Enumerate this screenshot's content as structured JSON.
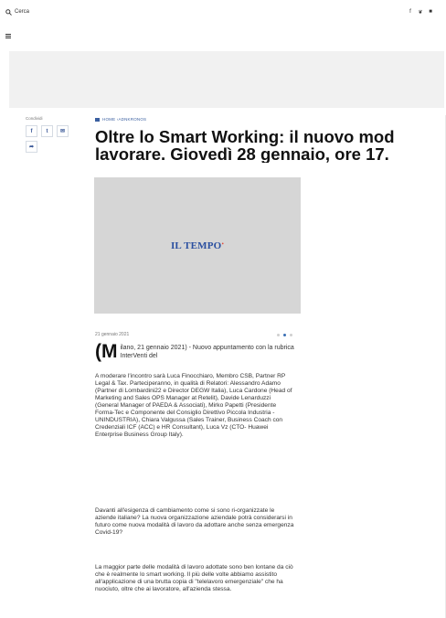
{
  "topbar": {
    "search_label": "Cerca",
    "social": [
      "f",
      "❦",
      "■"
    ]
  },
  "share": {
    "label": "Condividi",
    "buttons": [
      "f",
      "t",
      "✉",
      "➦"
    ]
  },
  "article": {
    "breadcrumb": "HOME ›ADNKRONOS",
    "title_line1": "Oltre lo Smart Working: il nuovo mod",
    "title_line2": "lavorare. Giovedì 28 gennaio, ore 17.",
    "image_logo": "IL TEMPO",
    "date": "21 gennaio 2021",
    "lead_dropcap": "(M",
    "lead_text": "ilano, 21 gennaio 2021) - Nuovo appuntamento con la rubrica InterVenti del",
    "paragraph1": "A moderare l'incontro sarà Luca Finocchiaro, Membro CSB, Partner RP Legal & Tax. Parteciperanno, in qualità di Relatori: Alessandro Adamo (Partner di Lombardini22 e Director DEGW Italia), Luca Cardone (Head of Marketing and Sales OPS Manager at Retelit), Davide Lenarduzzi (General Manager of PAEDA & Associati), Mirko Papetti (Presidente Forma-Tec e Componente del Consiglio Direttivo Piccola Industria - UNINDUSTRIA), Chiara Valgussa (Sales Trainer, Business Coach con Credenziali ICF (ACC) e HR Consultant), Luca Vz (CTO- Huawei Enterprise Business Group Italy).",
    "paragraph2": "Davanti all'esigenza di cambiamento come si sono ri-organizzate le aziende italiane? La nuova organizzazione aziendale potrà considerarsi in futuro come nuova modalità di lavoro da adottare anche senza emergenza Covid-19?",
    "paragraph3": "La maggior parte delle modalità di lavoro adottate sono ben lontane da ciò che è realmente lo smart working. Il più delle volte abbiamo assistito all'applicazione di una brutta copia di \"telelavoro emergenziale\" che ha nuociuto, oltre che ai lavoratore, all'azienda stessa."
  },
  "colors": {
    "accent": "#3a5fa0",
    "ad_band": "#f1f1f1",
    "image_placeholder": "#d6d6d6"
  }
}
